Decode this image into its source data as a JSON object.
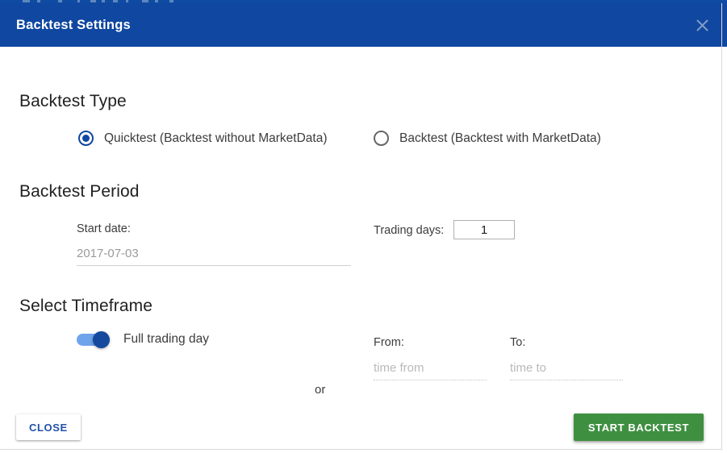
{
  "dialog": {
    "title": "Backtest Settings",
    "close_icon": "close-x-icon"
  },
  "sections": {
    "backtest_type": {
      "heading": "Backtest Type",
      "options": [
        {
          "label": "Quicktest (Backtest without MarketData)",
          "selected": true
        },
        {
          "label": "Backtest (Backtest with MarketData)",
          "selected": false
        }
      ]
    },
    "backtest_period": {
      "heading": "Backtest Period",
      "start_date": {
        "label": "Start date:",
        "value": "",
        "placeholder": "2017-07-03"
      },
      "trading_days": {
        "label": "Trading days:",
        "value": "1"
      }
    },
    "select_timeframe": {
      "heading": "Select Timeframe",
      "full_trading_day": {
        "label": "Full trading day",
        "enabled": true
      },
      "or_label": "or",
      "from": {
        "label": "From:",
        "value": "",
        "placeholder": "time from"
      },
      "to": {
        "label": "To:",
        "value": "",
        "placeholder": "time to"
      }
    }
  },
  "footer": {
    "close_label": "CLOSE",
    "start_label": "START BACKTEST"
  },
  "colors": {
    "header_blue": "#0f47a1",
    "accent_blue": "#2352a8",
    "start_green": "#3f8f41",
    "toggle_track": "#6fa3ea",
    "toggle_thumb": "#14499e"
  }
}
